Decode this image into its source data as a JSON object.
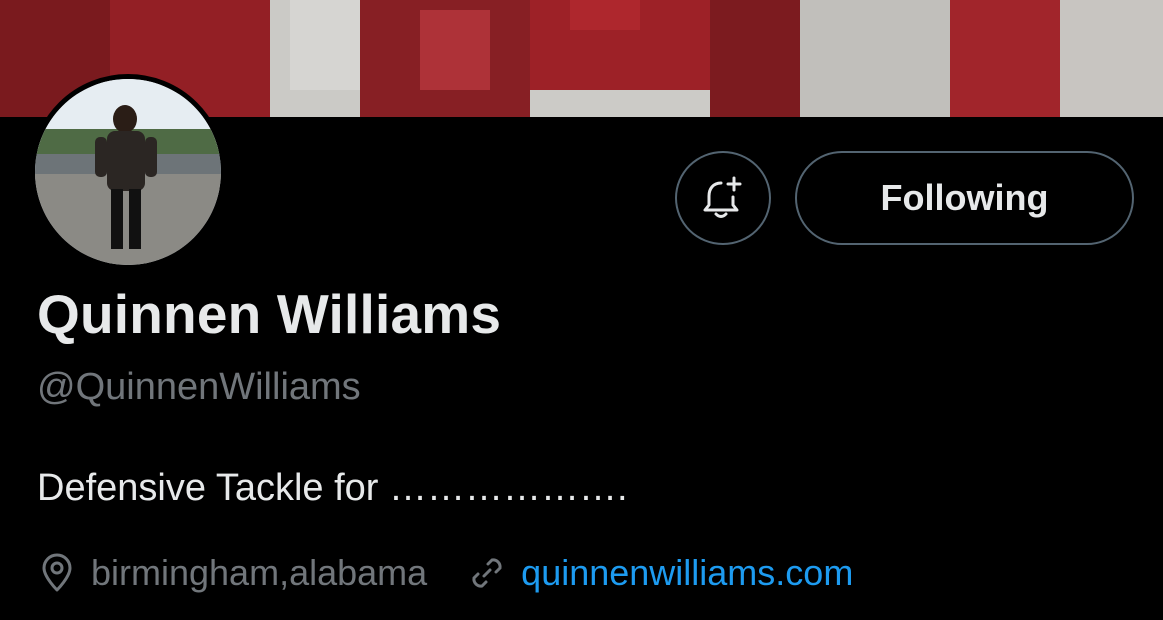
{
  "profile": {
    "display_name": "Quinnen Williams",
    "handle": "@QuinnenWilliams",
    "bio": "Defensive Tackle for ……………….",
    "location": "birmingham,alabama",
    "website": "quinnenwilliams.com"
  },
  "actions": {
    "following_label": "Following",
    "bell_icon": "bell-plus-icon"
  },
  "icons": {
    "location": "location-pin-icon",
    "link": "link-icon"
  },
  "colors": {
    "background": "#000000",
    "text_primary": "#e7e9ea",
    "text_secondary": "#71767b",
    "link": "#1d9bf0",
    "button_border": "#536471"
  }
}
